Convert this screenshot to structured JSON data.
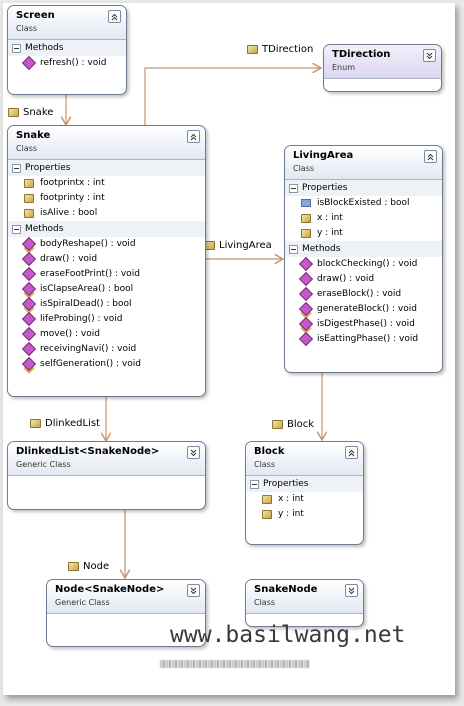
{
  "classes": {
    "screen": {
      "name": "Screen",
      "kind": "Class",
      "sections": [
        {
          "title": "Methods",
          "items": [
            {
              "text": "refresh() : void",
              "icon": "method-icon"
            }
          ]
        }
      ]
    },
    "tdirection": {
      "name": "TDirection",
      "kind": "Enum",
      "sections": []
    },
    "snake": {
      "name": "Snake",
      "kind": "Class",
      "sections": [
        {
          "title": "Properties",
          "items": [
            {
              "text": "footprintx : int",
              "icon": "property-icon"
            },
            {
              "text": "footprinty : int",
              "icon": "property-icon"
            },
            {
              "text": "isAlive : bool",
              "icon": "property-icon"
            }
          ]
        },
        {
          "title": "Methods",
          "items": [
            {
              "text": "bodyReshape() : void",
              "icon": "protected-method-icon"
            },
            {
              "text": "draw() : void",
              "icon": "method-icon"
            },
            {
              "text": "eraseFootPrint() : void",
              "icon": "method-icon"
            },
            {
              "text": "isClapseArea() : bool",
              "icon": "protected-method-icon"
            },
            {
              "text": "isSpiralDead() : bool",
              "icon": "protected-method-icon"
            },
            {
              "text": "lifeProbing() : void",
              "icon": "method-icon"
            },
            {
              "text": "move() : void",
              "icon": "method-icon"
            },
            {
              "text": "receivingNavi() : void",
              "icon": "method-icon"
            },
            {
              "text": "selfGeneration() : void",
              "icon": "protected-method-icon"
            }
          ]
        }
      ]
    },
    "livingarea": {
      "name": "LivingArea",
      "kind": "Class",
      "sections": [
        {
          "title": "Properties",
          "items": [
            {
              "text": "isBlockExisted : bool",
              "icon": "field-icon"
            },
            {
              "text": "x : int",
              "icon": "property-icon"
            },
            {
              "text": "y : int",
              "icon": "property-icon"
            }
          ]
        },
        {
          "title": "Methods",
          "items": [
            {
              "text": "blockChecking() : void",
              "icon": "method-icon"
            },
            {
              "text": "draw() : void",
              "icon": "method-icon"
            },
            {
              "text": "eraseBlock() : void",
              "icon": "method-icon"
            },
            {
              "text": "generateBlock() : void",
              "icon": "protected-method-icon"
            },
            {
              "text": "isDigestPhase() : void",
              "icon": "protected-method-icon"
            },
            {
              "text": "isEattingPhase() : void",
              "icon": "method-icon"
            }
          ]
        }
      ]
    },
    "dlinkedlist": {
      "name": "DlinkedList<SnakeNode>",
      "kind": "Generic Class",
      "sections": []
    },
    "block": {
      "name": "Block",
      "kind": "Class",
      "sections": [
        {
          "title": "Properties",
          "items": [
            {
              "text": "x : int",
              "icon": "property-icon"
            },
            {
              "text": "y : int",
              "icon": "property-icon"
            }
          ]
        }
      ]
    },
    "node": {
      "name": "Node<SnakeNode>",
      "kind": "Generic Class",
      "sections": []
    },
    "snakenode": {
      "name": "SnakeNode",
      "kind": "Class",
      "sections": []
    }
  },
  "associations": {
    "tdirection": "TDirection",
    "snake": "Snake",
    "livingarea": "LivingArea",
    "dlinkedlist": "DlinkedList",
    "block": "Block",
    "node": "Node"
  },
  "watermark": "www.basilwang.net",
  "colors": {
    "border": "#6f7b8f",
    "arrow": "#c9936b",
    "header": "#e2e8f2",
    "enum_header": "#ddd6f0"
  }
}
